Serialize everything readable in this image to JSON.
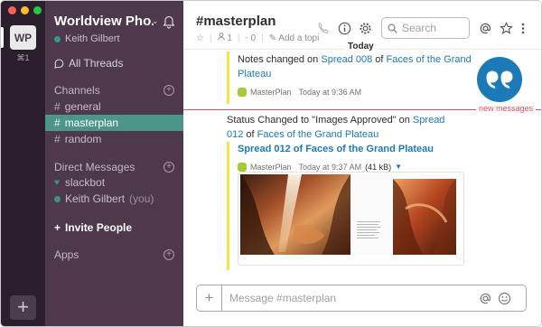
{
  "teams": {
    "current_initials": "WP",
    "current_shortcut": "⌘1",
    "add_label": "+"
  },
  "sidebar": {
    "workspace_name": "Worldview Pho...",
    "user_name": "Keith Gilbert",
    "all_threads": "All Threads",
    "channels_heading": "Channels",
    "channels": [
      {
        "name": "general"
      },
      {
        "name": "masterplan",
        "active": true
      },
      {
        "name": "random"
      }
    ],
    "dm_heading": "Direct Messages",
    "dms": [
      {
        "name": "slackbot",
        "suffix": ""
      },
      {
        "name": "Keith Gilbert",
        "suffix": "(you)"
      }
    ],
    "invite_label": "Invite People",
    "apps_heading": "Apps"
  },
  "header": {
    "channel": "#masterplan",
    "members": "1",
    "pins": "0",
    "add_topic": "Add a topi",
    "search_placeholder": "Search"
  },
  "messages": {
    "day_divider": "Today",
    "new_messages_label": "new messages",
    "m1": {
      "prefix": "Notes changed on ",
      "link1": "Spread 008",
      "mid": " of ",
      "link2": "Faces of the Grand Plateau",
      "app": "MasterPlan",
      "time": "Today at 9:36 AM"
    },
    "m2": {
      "prefix": "Status Changed to \"Images Approved\" on ",
      "link1": "Spread 012",
      "mid": " of ",
      "link2": "Faces of the Grand Plateau",
      "attachment_title": "Spread 012 of Faces of the Grand Plateau",
      "app": "MasterPlan",
      "time": "Today at 9:37 AM",
      "size": "(41 kB)"
    }
  },
  "composer": {
    "placeholder": "Message #masterplan"
  },
  "colors": {
    "sidebar": "#4d394b",
    "team_column": "#2b1f2d",
    "active_channel": "#4c9689",
    "link": "#1d7ab9",
    "attachment_bar": "#f3e73d",
    "new_messages": "#eb4d5c"
  }
}
